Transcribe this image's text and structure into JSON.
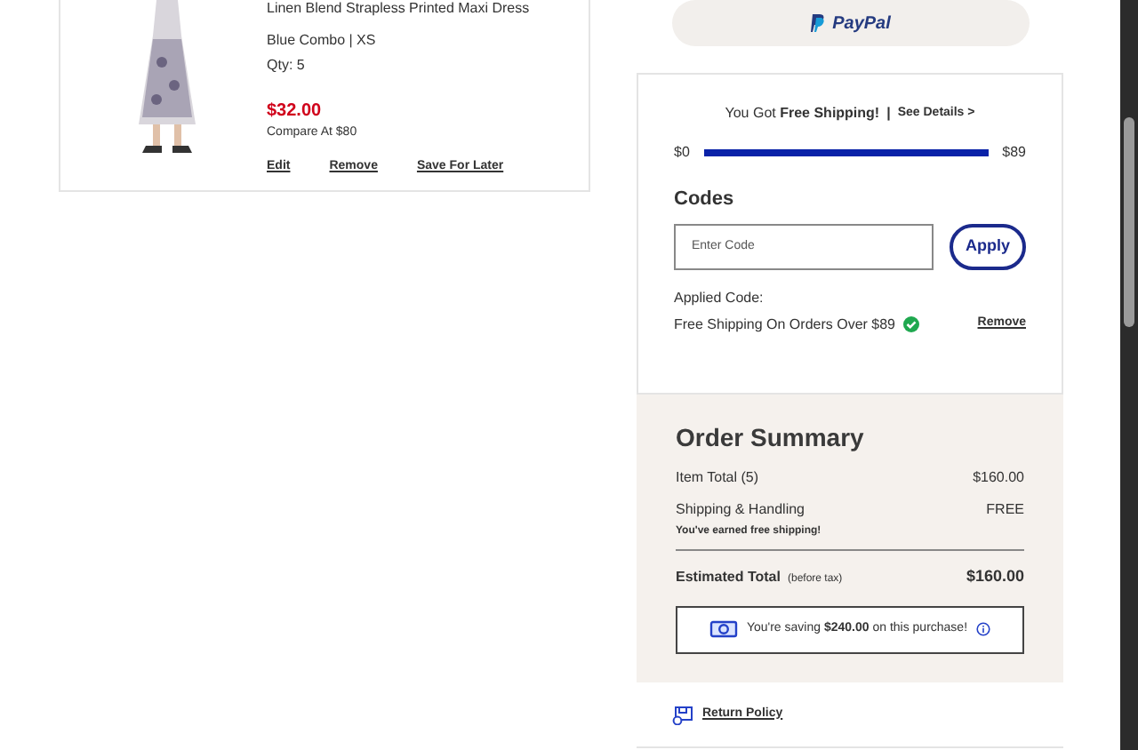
{
  "cart_item": {
    "title": "Linen Blend Strapless Printed Maxi Dress",
    "variant": "Blue Combo | XS",
    "quantity": "Qty: 5",
    "price": "$32.00",
    "compare_at": "Compare At $80",
    "actions": [
      "Edit",
      "Remove",
      "Save For Later"
    ]
  },
  "paypal_button": {
    "label": "PayPal"
  },
  "shipping": {
    "message": "You Got **Free Shipping!**",
    "separator": "|",
    "details_link": "See Details",
    "details_caret": ">",
    "min_label": "$0",
    "max_label": "$89",
    "level": 1
  },
  "codes": {
    "heading": "Codes",
    "placeholder": "Enter Code",
    "apply_button": "Apply",
    "applied_label": "Applied Code:",
    "applied_code": "Free Shipping On Orders Over $89",
    "applied_valid": true,
    "remove_link": "Remove"
  },
  "order_summary": {
    "heading": "Order Summary",
    "rows": [
      {
        "label": "Item Total (5)",
        "value": "$160.00"
      },
      {
        "label": "Shipping & Handling",
        "value": "FREE",
        "note": "You've earned free shipping!"
      }
    ],
    "total_label": "Estimated Total",
    "total_note": "(before tax)",
    "total_value": "$160.00",
    "savings": "You're saving **$240.00** on this purchase!"
  },
  "return_policy": {
    "label": "Return Policy"
  }
}
